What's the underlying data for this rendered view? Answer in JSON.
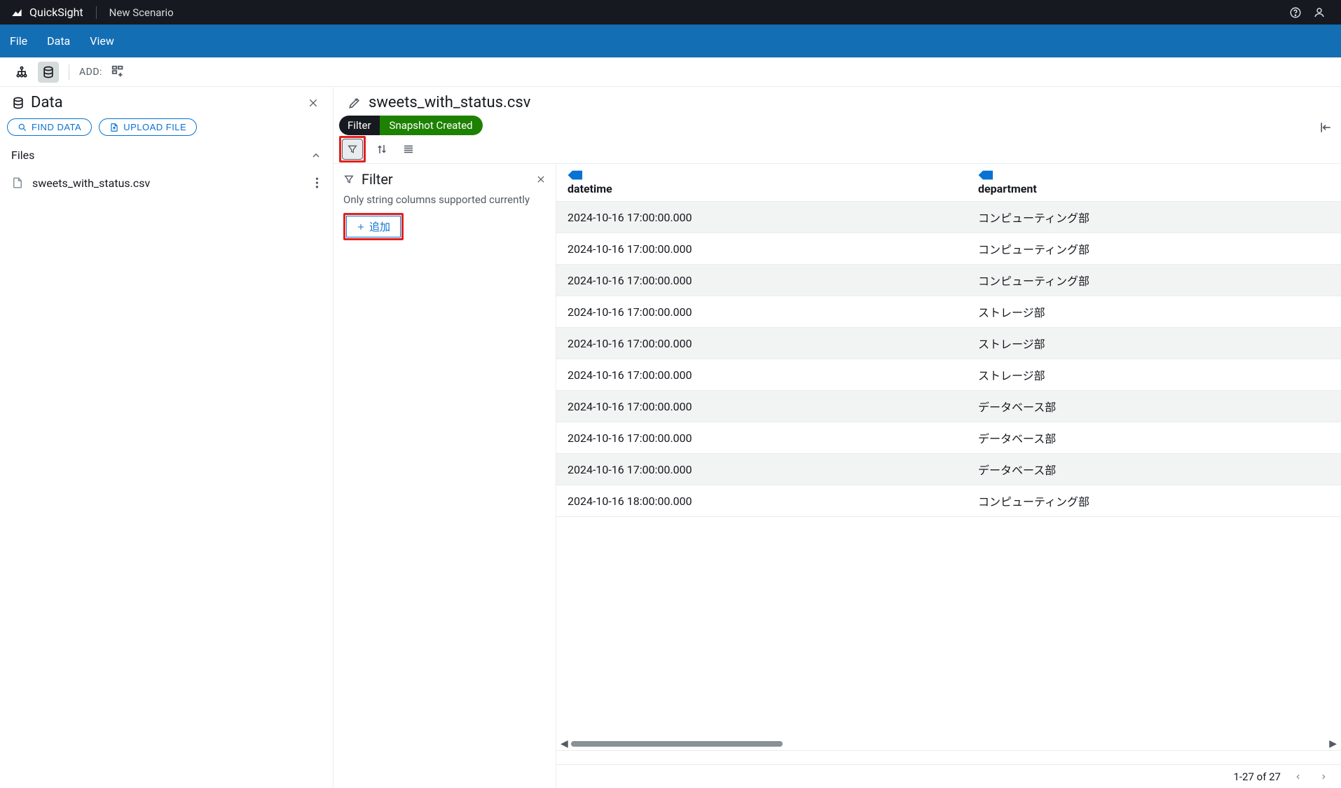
{
  "topbar": {
    "brand": "QuickSight",
    "scenario": "New Scenario"
  },
  "menubar": {
    "items": [
      "File",
      "Data",
      "View"
    ]
  },
  "toolrow": {
    "add_label": "ADD:"
  },
  "left": {
    "title": "Data",
    "find_btn": "FIND DATA",
    "upload_btn": "UPLOAD FILE",
    "files_head": "Files",
    "file_name": "sweets_with_status.csv"
  },
  "center": {
    "title": "sweets_with_status.csv",
    "pill_left": "Filter",
    "pill_right": "Snapshot Created",
    "filter_title": "Filter",
    "filter_note": "Only string columns supported currently",
    "add_btn": "追加"
  },
  "table": {
    "columns": [
      "datetime",
      "department"
    ],
    "rows": [
      {
        "datetime": "2024-10-16 17:00:00.000",
        "department": "コンピューティング部"
      },
      {
        "datetime": "2024-10-16 17:00:00.000",
        "department": "コンピューティング部"
      },
      {
        "datetime": "2024-10-16 17:00:00.000",
        "department": "コンピューティング部"
      },
      {
        "datetime": "2024-10-16 17:00:00.000",
        "department": "ストレージ部"
      },
      {
        "datetime": "2024-10-16 17:00:00.000",
        "department": "ストレージ部"
      },
      {
        "datetime": "2024-10-16 17:00:00.000",
        "department": "ストレージ部"
      },
      {
        "datetime": "2024-10-16 17:00:00.000",
        "department": "データベース部"
      },
      {
        "datetime": "2024-10-16 17:00:00.000",
        "department": "データベース部"
      },
      {
        "datetime": "2024-10-16 17:00:00.000",
        "department": "データベース部"
      },
      {
        "datetime": "2024-10-16 18:00:00.000",
        "department": "コンピューティング部"
      }
    ]
  },
  "footer": {
    "range": "1-27 of 27"
  }
}
